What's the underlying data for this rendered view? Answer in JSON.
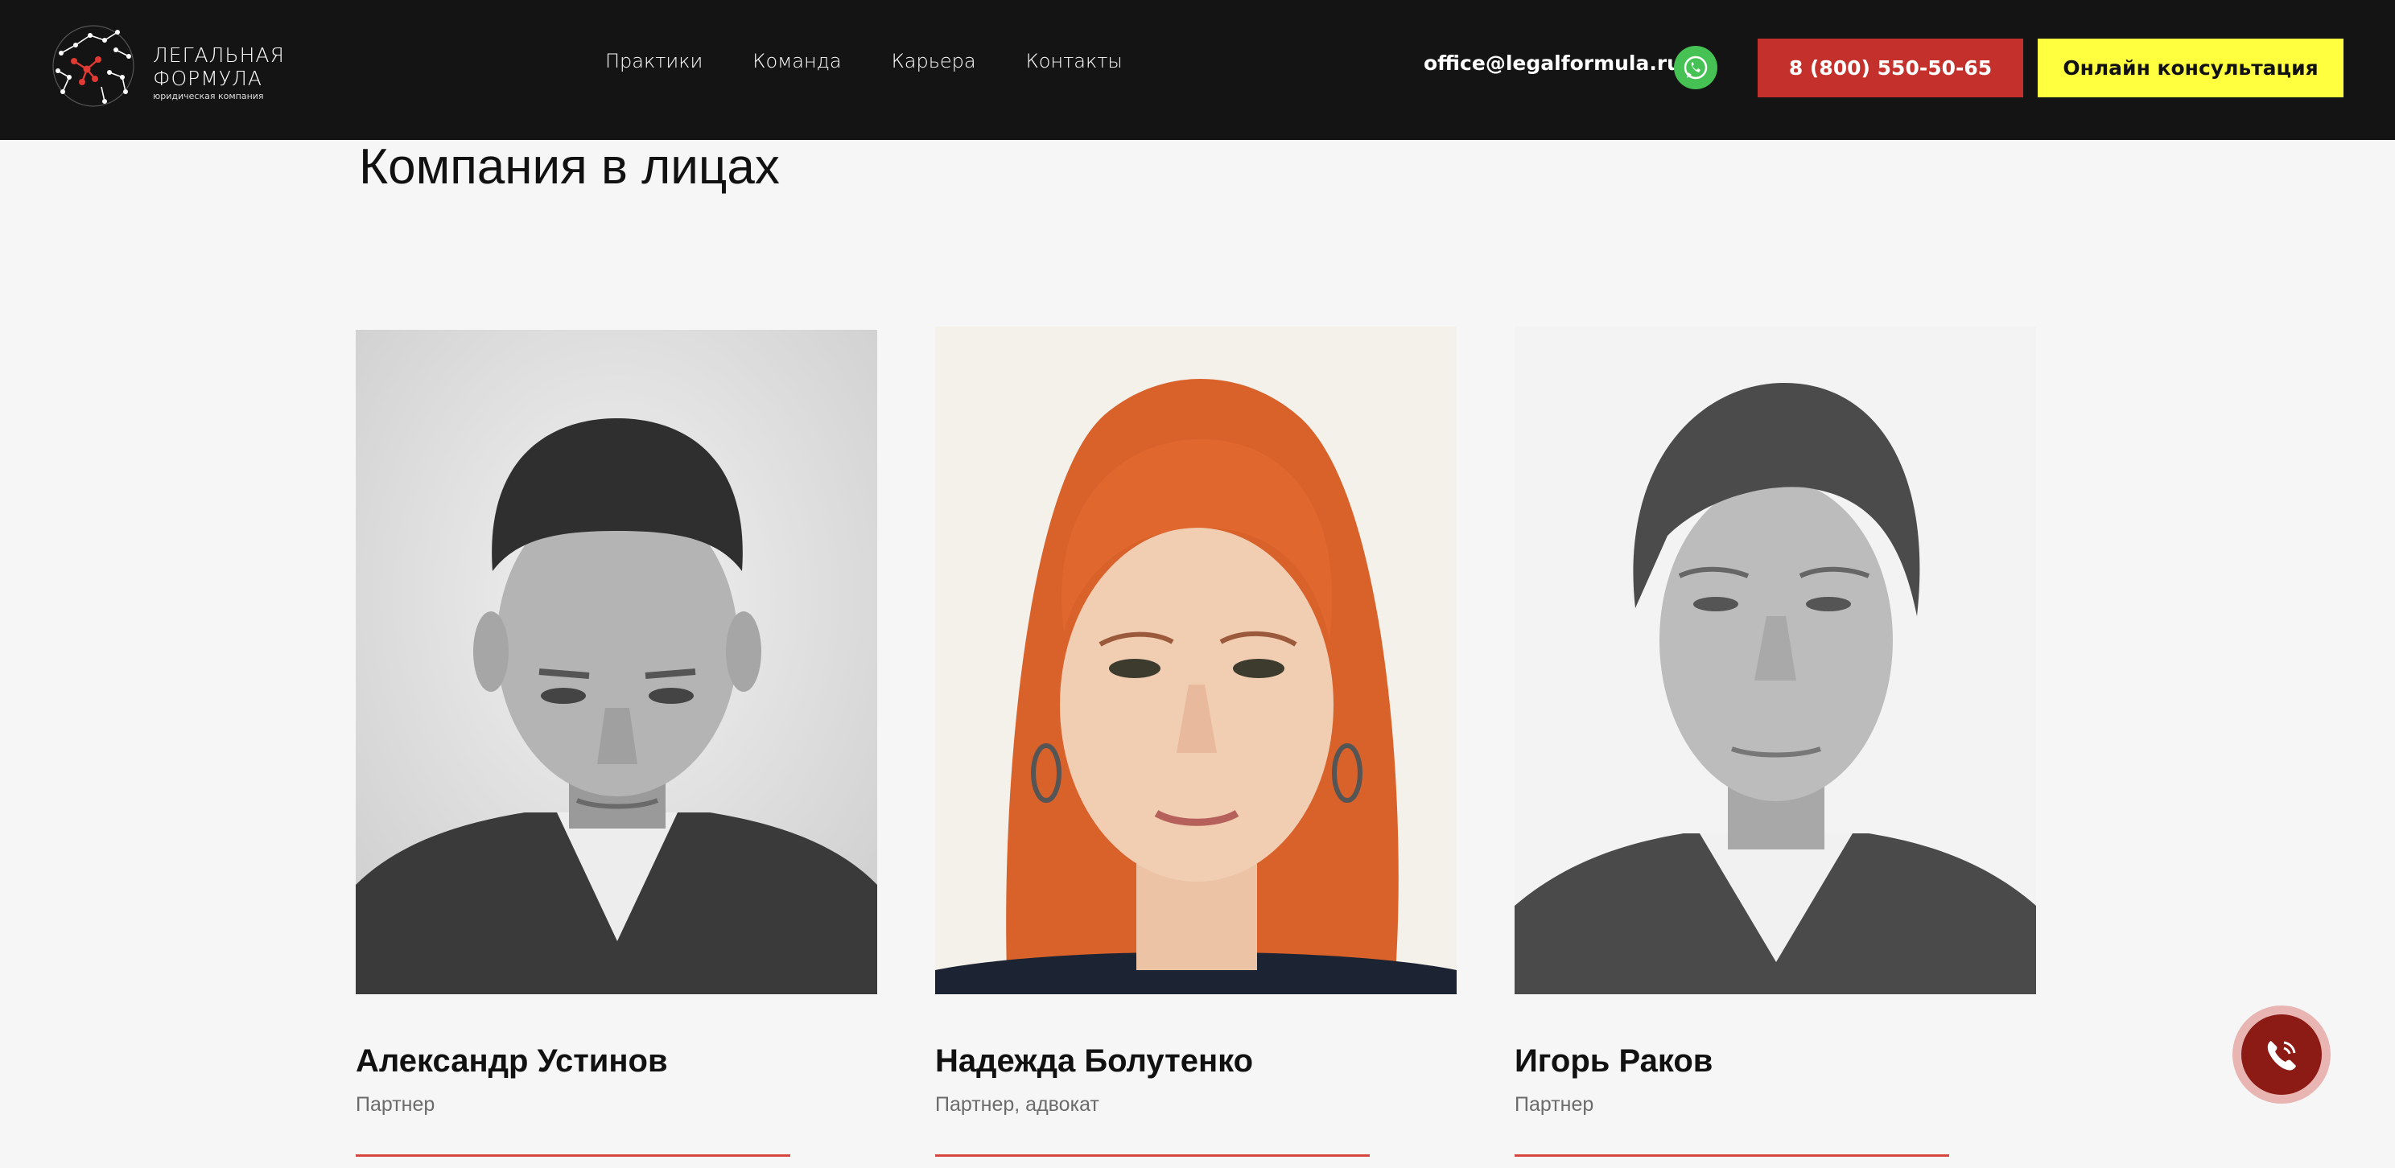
{
  "header": {
    "logo": {
      "line1": "ЛЕГАЛЬНАЯ",
      "line2": "ФОРМУЛА",
      "sub": "юридическая компания"
    },
    "nav": [
      "Практики",
      "Команда",
      "Карьера",
      "Контакты"
    ],
    "email": "office@legalformula.ru",
    "whatsapp_icon": "whatsapp-icon",
    "phone_button": "8 (800) 550-50-65",
    "consult_button": "Онлайн консультация",
    "colors": {
      "background": "#141414",
      "phone_button": "#c4302b",
      "consult_button": "#ffff3f",
      "whatsapp": "#46c255"
    }
  },
  "main": {
    "title": "Компания в лицах",
    "team": [
      {
        "name": "Александр Устинов",
        "role": "Партнер",
        "photo": "black-and-white portrait"
      },
      {
        "name": "Надежда Болутенко",
        "role": "Партнер, адвокат",
        "photo": "color portrait"
      },
      {
        "name": "Игорь Раков",
        "role": "Партнер",
        "photo": "black-and-white portrait"
      }
    ],
    "accent_color": "#d6463e"
  },
  "call_button": {
    "icon": "phone-call-icon",
    "color": "#8c1a15"
  }
}
